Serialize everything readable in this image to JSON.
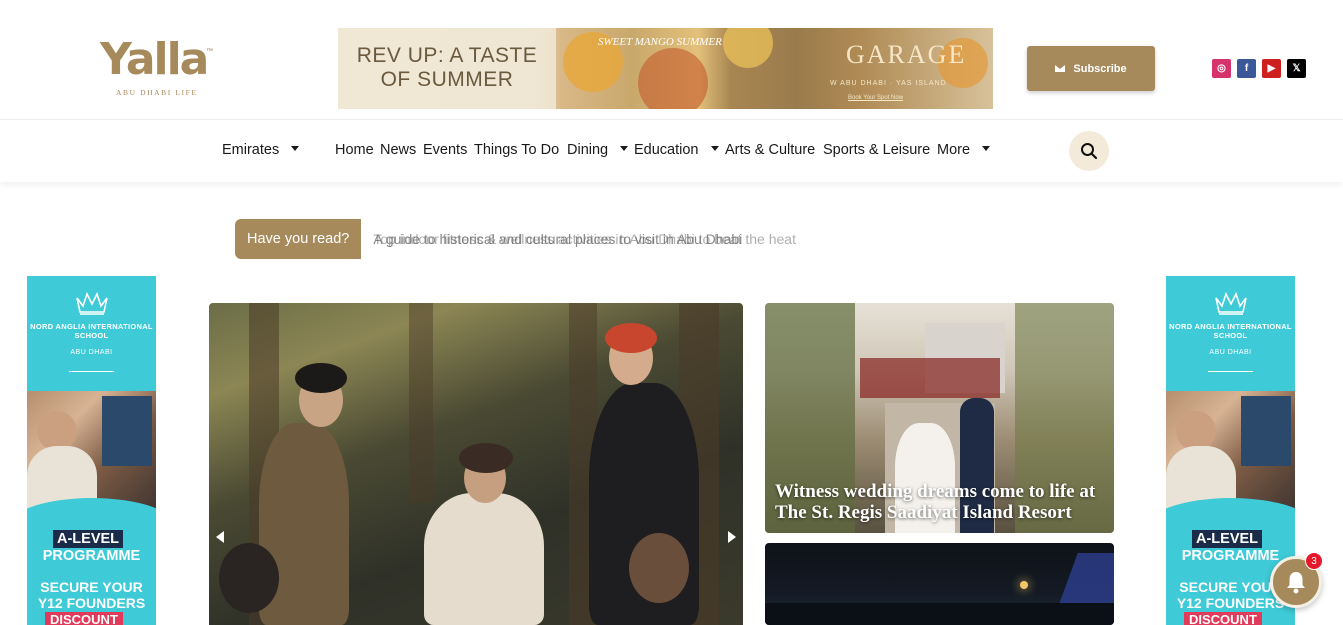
{
  "header": {
    "logo_text": "Yalla",
    "logo_tagline": "ABU DHABI LIFE",
    "subscribe_label": "Subscribe",
    "banner": {
      "headline": "REV UP: A TASTE OF SUMMER",
      "promo_name": "SWEET MANGO SUMMER",
      "brand": "GARAGE",
      "location": "W ABU DHABI · YAS ISLAND",
      "cta": "Book Your Spot Now"
    },
    "socials": [
      {
        "name": "instagram-icon",
        "glyph": "◎"
      },
      {
        "name": "facebook-icon",
        "glyph": "f"
      },
      {
        "name": "youtube-icon",
        "glyph": "▶"
      },
      {
        "name": "x-icon",
        "glyph": "𝕏"
      }
    ]
  },
  "nav": {
    "emirates": "Emirates",
    "home": "Home",
    "news": "News",
    "events": "Events",
    "things_to_do": "Things To Do",
    "dining": "Dining",
    "education": "Education",
    "arts_culture": "Arts & Culture",
    "sports_leisure": "Sports & Leisure",
    "more": "More"
  },
  "ticker": {
    "label": "Have you read?",
    "headline": "A guide to historical and cultural places to visit in Abu Dhabi",
    "headline_behind": "Top indoor fitness & wellness activities in Abu Dhabi to beat the heat"
  },
  "side_ad": {
    "school": "NORD ANGLIA INTERNATIONAL SCHOOL",
    "city": "ABU DHABI",
    "tag": "A-LEVEL",
    "programme": "PROGRAMME",
    "secure": "SECURE YOUR Y12 FOUNDERS",
    "discount": "DISCOUNT"
  },
  "featured": {
    "card1_title": "Witness wedding dreams come to life at The St. Regis Saadiyat Island Resort"
  },
  "notifications": {
    "count": "3"
  }
}
